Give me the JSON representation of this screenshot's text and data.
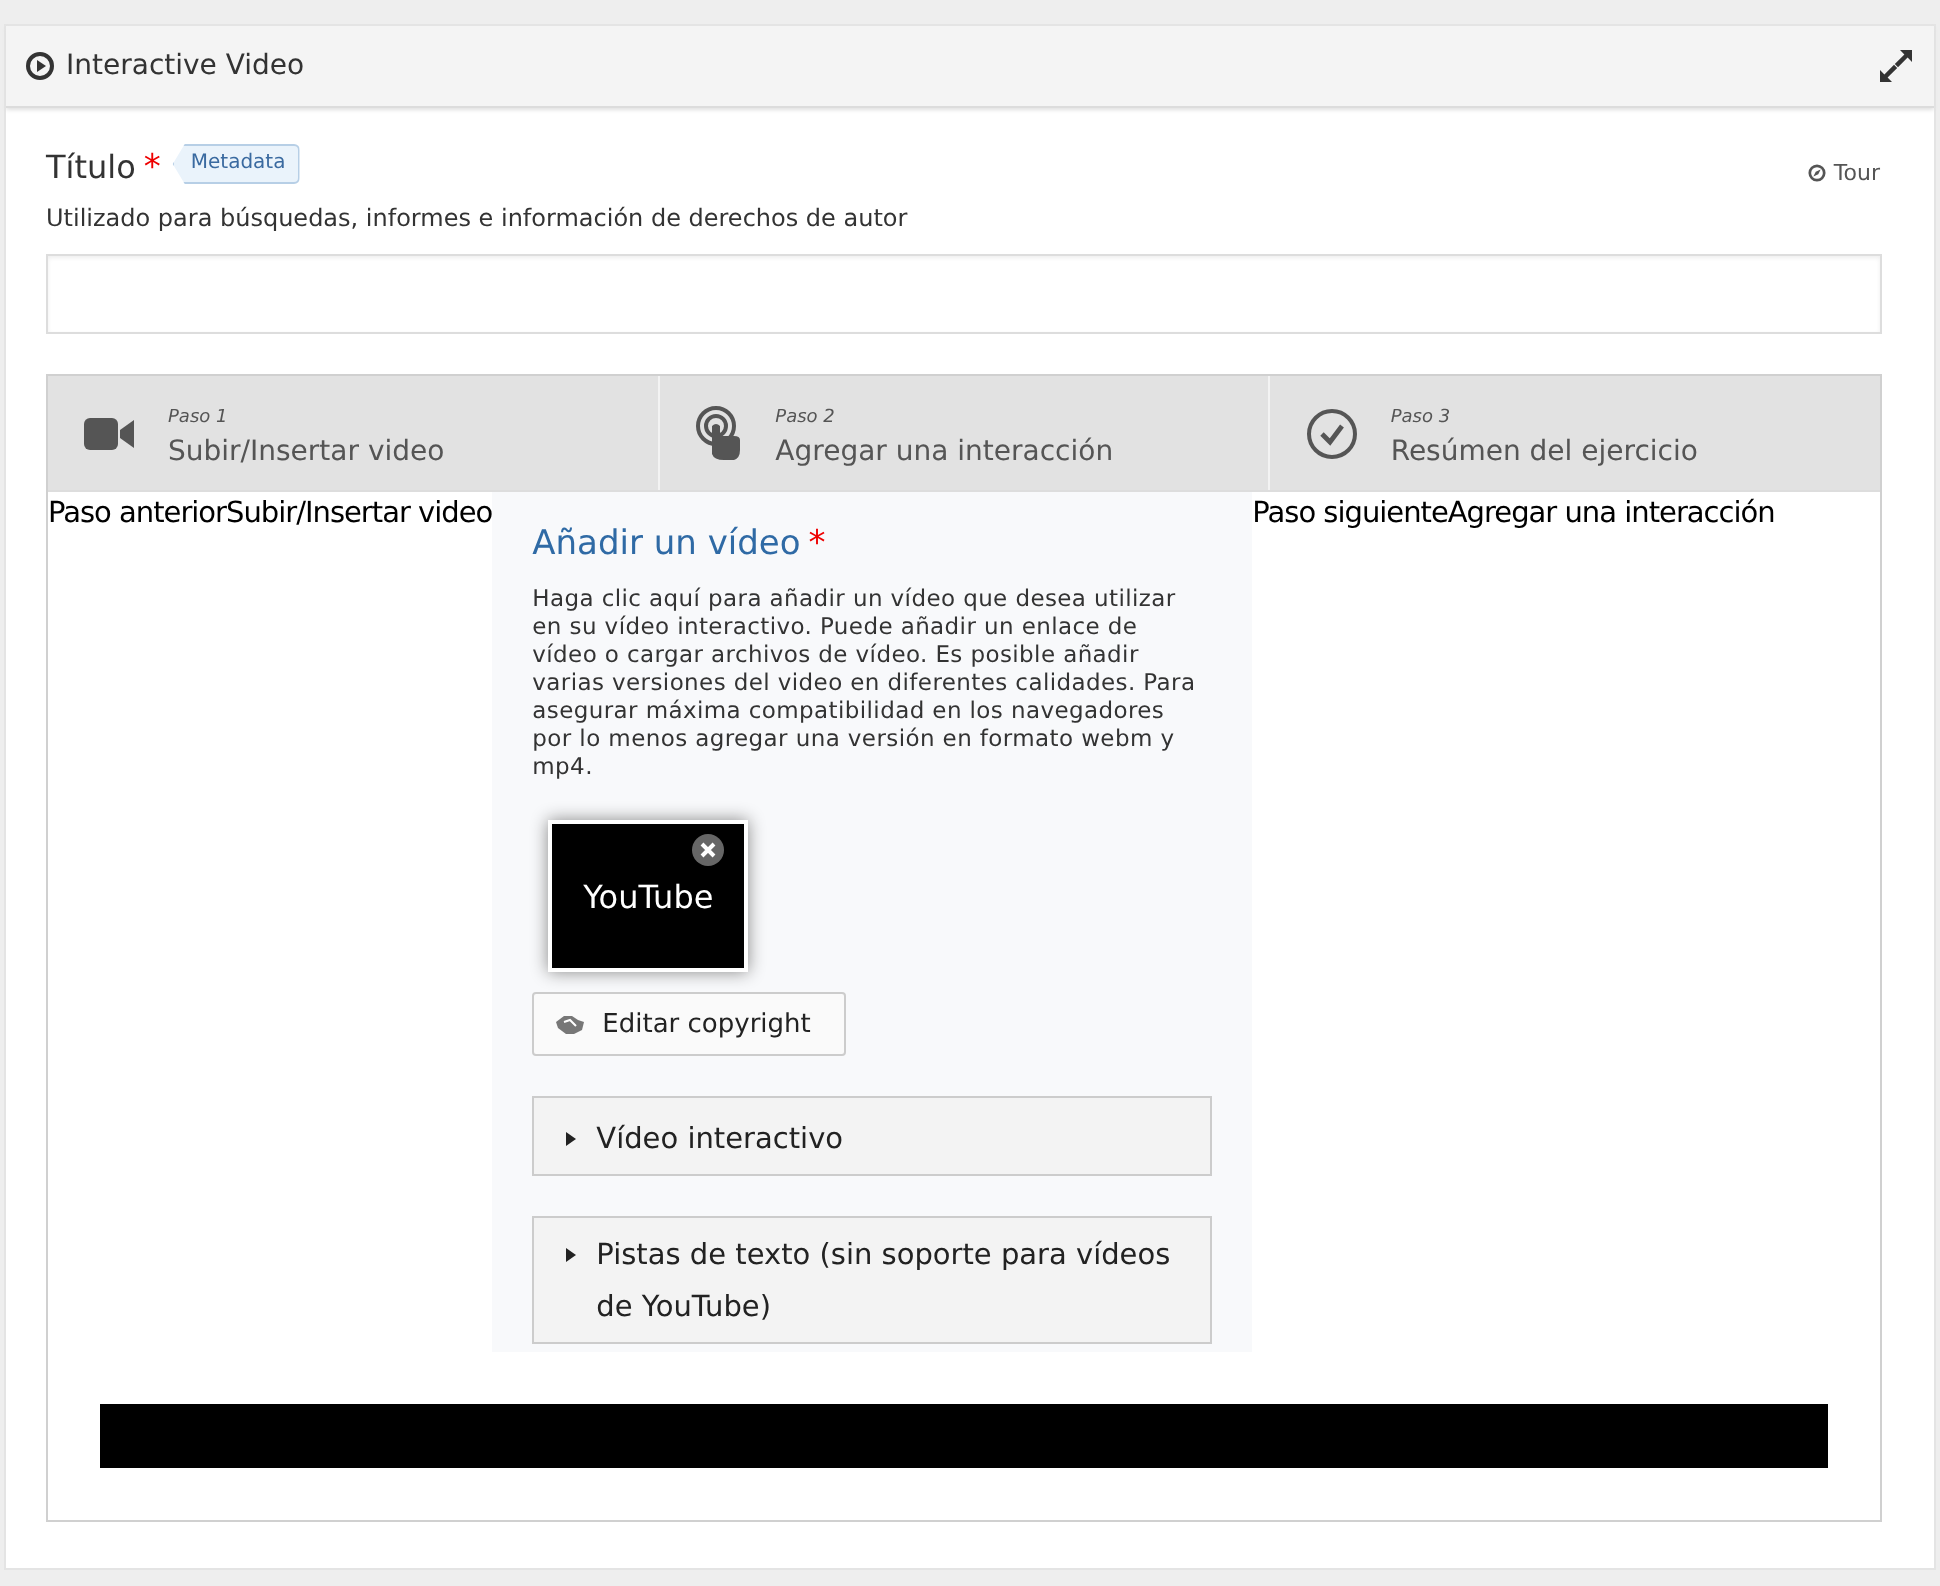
{
  "header": {
    "title": "Interactive Video"
  },
  "title_field": {
    "label": "Título",
    "required_mark": "*",
    "badge": "Metadata",
    "description": "Utilizado para búsquedas, informes e información de derechos de autor"
  },
  "tour": "Tour",
  "steps": [
    {
      "number": "Paso 1",
      "label": "Subir/Insertar video",
      "kind": "camera"
    },
    {
      "number": "Paso 2",
      "label": "Agregar una interacción",
      "kind": "touch"
    },
    {
      "number": "Paso 3",
      "label": "Resúmen del ejercicio",
      "kind": "check"
    }
  ],
  "nav": {
    "previous": "Paso anteriorSubir/Insertar video",
    "next": "Paso siguienteAgregar una interacción"
  },
  "video_panel": {
    "title": "Añadir un vídeo",
    "required_mark": "*",
    "description": "Haga clic aquí para añadir un vídeo que desea utilizar en su vídeo interactivo. Puede añadir un enlace de vídeo o cargar archivos de vídeo. Es posible añadir varias versiones del video en diferentes calidades. Para asegurar máxima compatibilidad en los navegadores por lo menos agregar una versión en formato webm y mp4.",
    "file": "YouTube",
    "copyright_button": "Editar copyright",
    "sections": [
      {
        "label": "Vídeo interactivo",
        "expanded": false
      },
      {
        "label": "Pistas de texto (sin soporte para vídeos de YouTube)",
        "expanded": false
      }
    ]
  }
}
